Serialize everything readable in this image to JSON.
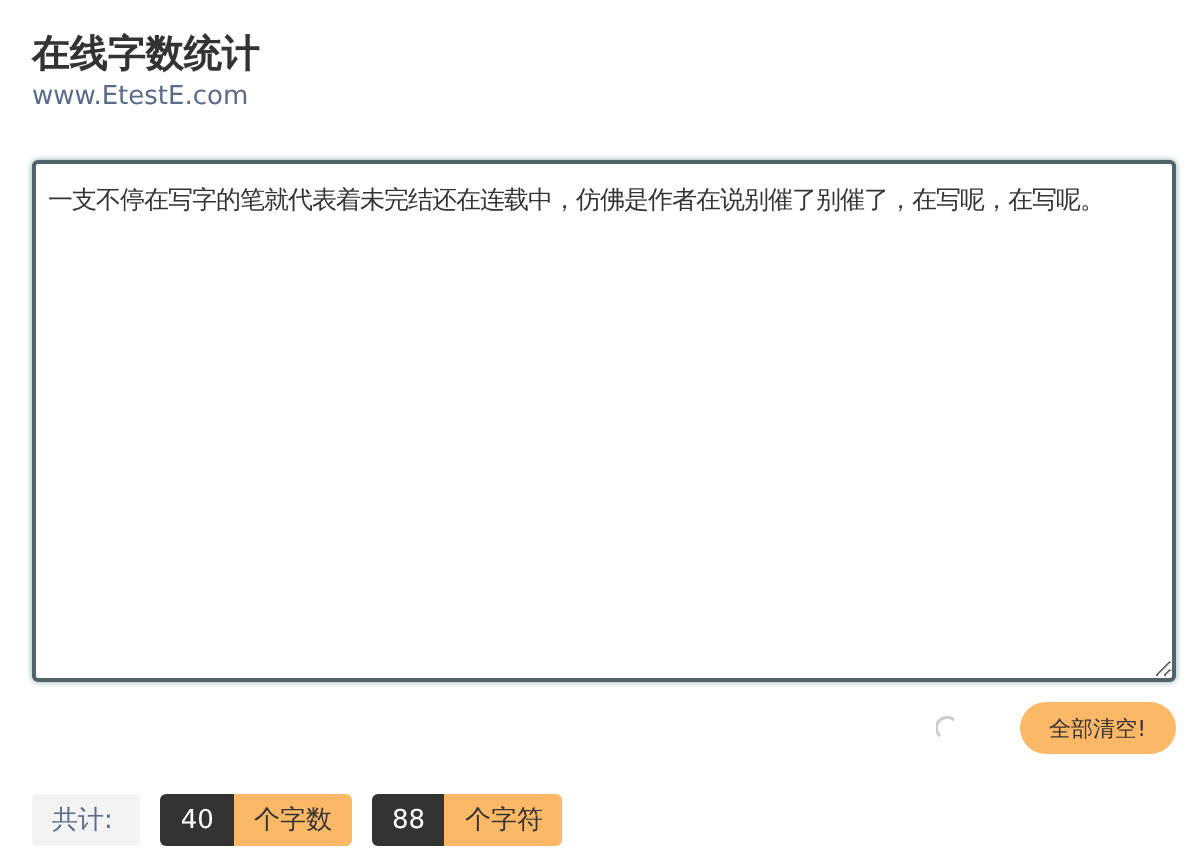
{
  "header": {
    "title": "在线字数统计",
    "url": "www.EtestE.com"
  },
  "editor": {
    "value": "一支不停在写字的笔就代表着未完结还在连载中，仿佛是作者在说别催了别催了，在写呢，在写呢。"
  },
  "actions": {
    "clear_button": "全部清空!"
  },
  "stats": {
    "label": "共计:",
    "items": [
      {
        "count": "40",
        "unit": "个字数"
      },
      {
        "count": "88",
        "unit": "个字符"
      }
    ]
  }
}
